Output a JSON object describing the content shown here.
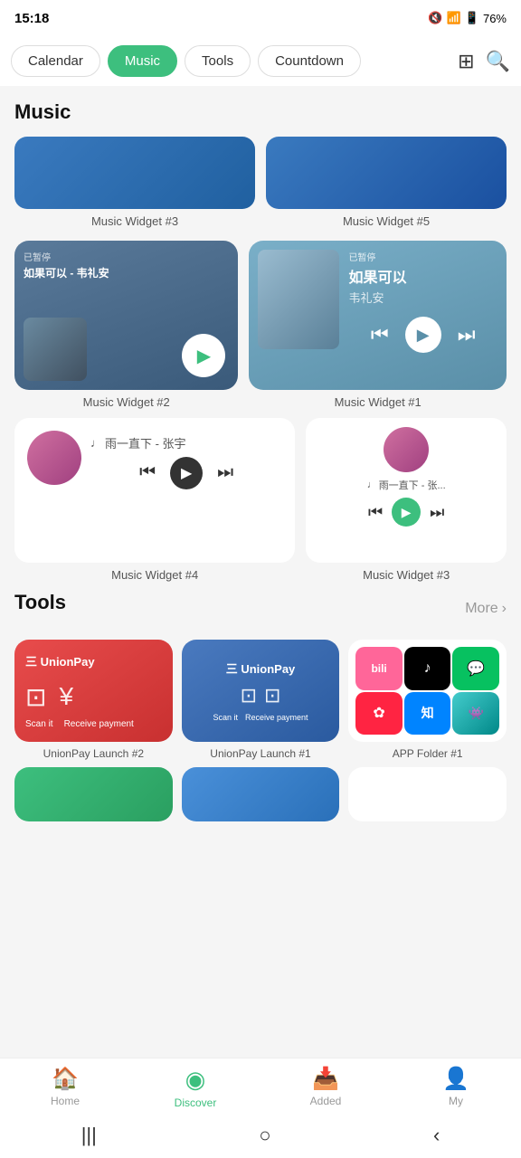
{
  "statusBar": {
    "time": "15:18",
    "battery": "76%"
  },
  "navTabs": {
    "tabs": [
      {
        "label": "Calendar",
        "active": false
      },
      {
        "label": "Music",
        "active": true
      },
      {
        "label": "Tools",
        "active": false
      },
      {
        "label": "Countdown",
        "active": false
      }
    ],
    "gridIcon": "⊞",
    "searchIcon": "🔍"
  },
  "musicSection": {
    "title": "Music",
    "widgets": [
      {
        "label": "Music Widget #3"
      },
      {
        "label": "Music Widget #5"
      },
      {
        "label": "Music Widget #2"
      },
      {
        "label": "Music Widget #1"
      },
      {
        "label": "Music Widget #4"
      },
      {
        "label": "Music Widget #3"
      }
    ],
    "track1": {
      "name": "如果可以 - 韦礼安",
      "status": "已暂停",
      "next": "下一首"
    },
    "track2": {
      "name": "如果可以",
      "artist": "韦礼安",
      "status": "已暂停"
    },
    "track3": {
      "name": "雨一直下 - 张宇",
      "display": "♩ 雨一直下 - 张宇"
    },
    "track4": {
      "name": "雨一直下 - 张...",
      "display": "♩ 雨一直下 - 张..."
    }
  },
  "toolsSection": {
    "title": "Tools",
    "moreLabel": "More",
    "tools": [
      {
        "label": "UnionPay Launch #2",
        "type": "red"
      },
      {
        "label": "UnionPay Launch #1",
        "type": "blue"
      },
      {
        "label": "APP Folder #1",
        "type": "grid"
      }
    ],
    "unionpayText": "UnionPay",
    "scanItLabel": "Scan it",
    "receiveLabel": "Receive payment"
  },
  "bottomNav": {
    "items": [
      {
        "icon": "🏠",
        "label": "Home",
        "active": false
      },
      {
        "icon": "◎",
        "label": "Discover",
        "active": true
      },
      {
        "icon": "＋",
        "label": "Added",
        "active": false
      },
      {
        "icon": "○",
        "label": "My",
        "active": false
      }
    ]
  },
  "systemNav": {
    "buttons": [
      "|||",
      "○",
      "‹"
    ]
  }
}
